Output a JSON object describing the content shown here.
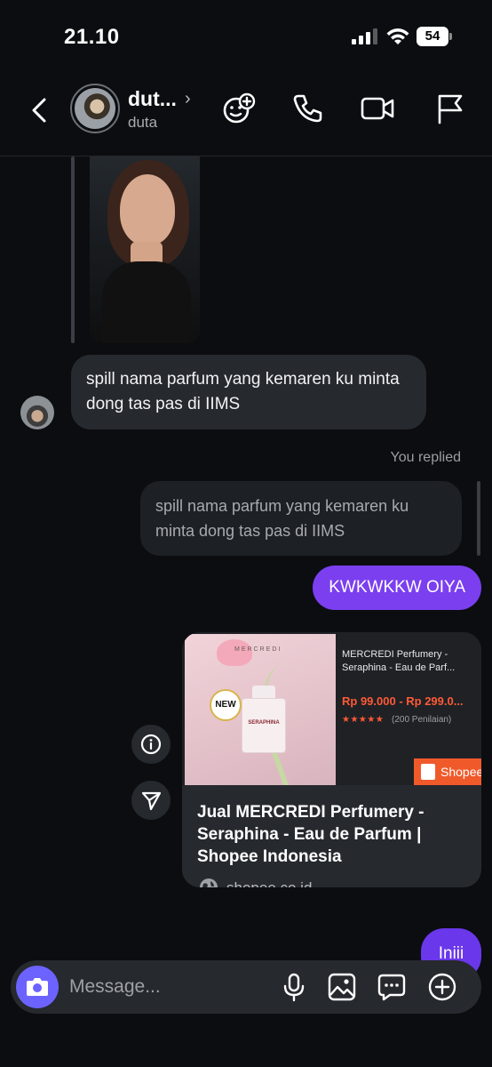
{
  "status_bar": {
    "time": "21.10",
    "battery": "54"
  },
  "header": {
    "name": "dut...",
    "username": "duta"
  },
  "thread": {
    "incoming_message": "spill nama parfum yang kemaren ku minta dong tas pas di IIMS",
    "you_replied_label": "You replied",
    "quoted_text": "spill nama parfum yang kemaren ku minta dong tas pas di IIMS",
    "outgoing_message": "KWKWKKW OIYA",
    "outgoing_message_2": "Iniii"
  },
  "link_preview": {
    "product_title": "MERCREDI Perfumery - Seraphina - Eau de Parf...",
    "price": "Rp 99.000 - Rp 299.0...",
    "stars": "★★★★★",
    "rating_count": "(200 Penilaian)",
    "shopee_label": "Shopee",
    "new_badge": "NEW",
    "bottle_label": "SERAPHINA",
    "brand": "MERCREDI",
    "title": "Jual MERCREDI Perfumery - Seraphina - Eau de Parfum | Shopee Indonesia",
    "domain": "shopee.co.id"
  },
  "composer": {
    "placeholder": "Message..."
  },
  "colors": {
    "accent": "#7b3ff0",
    "camera": "#6c63ff",
    "shopee": "#f05a2b",
    "price": "#ff5a36"
  }
}
